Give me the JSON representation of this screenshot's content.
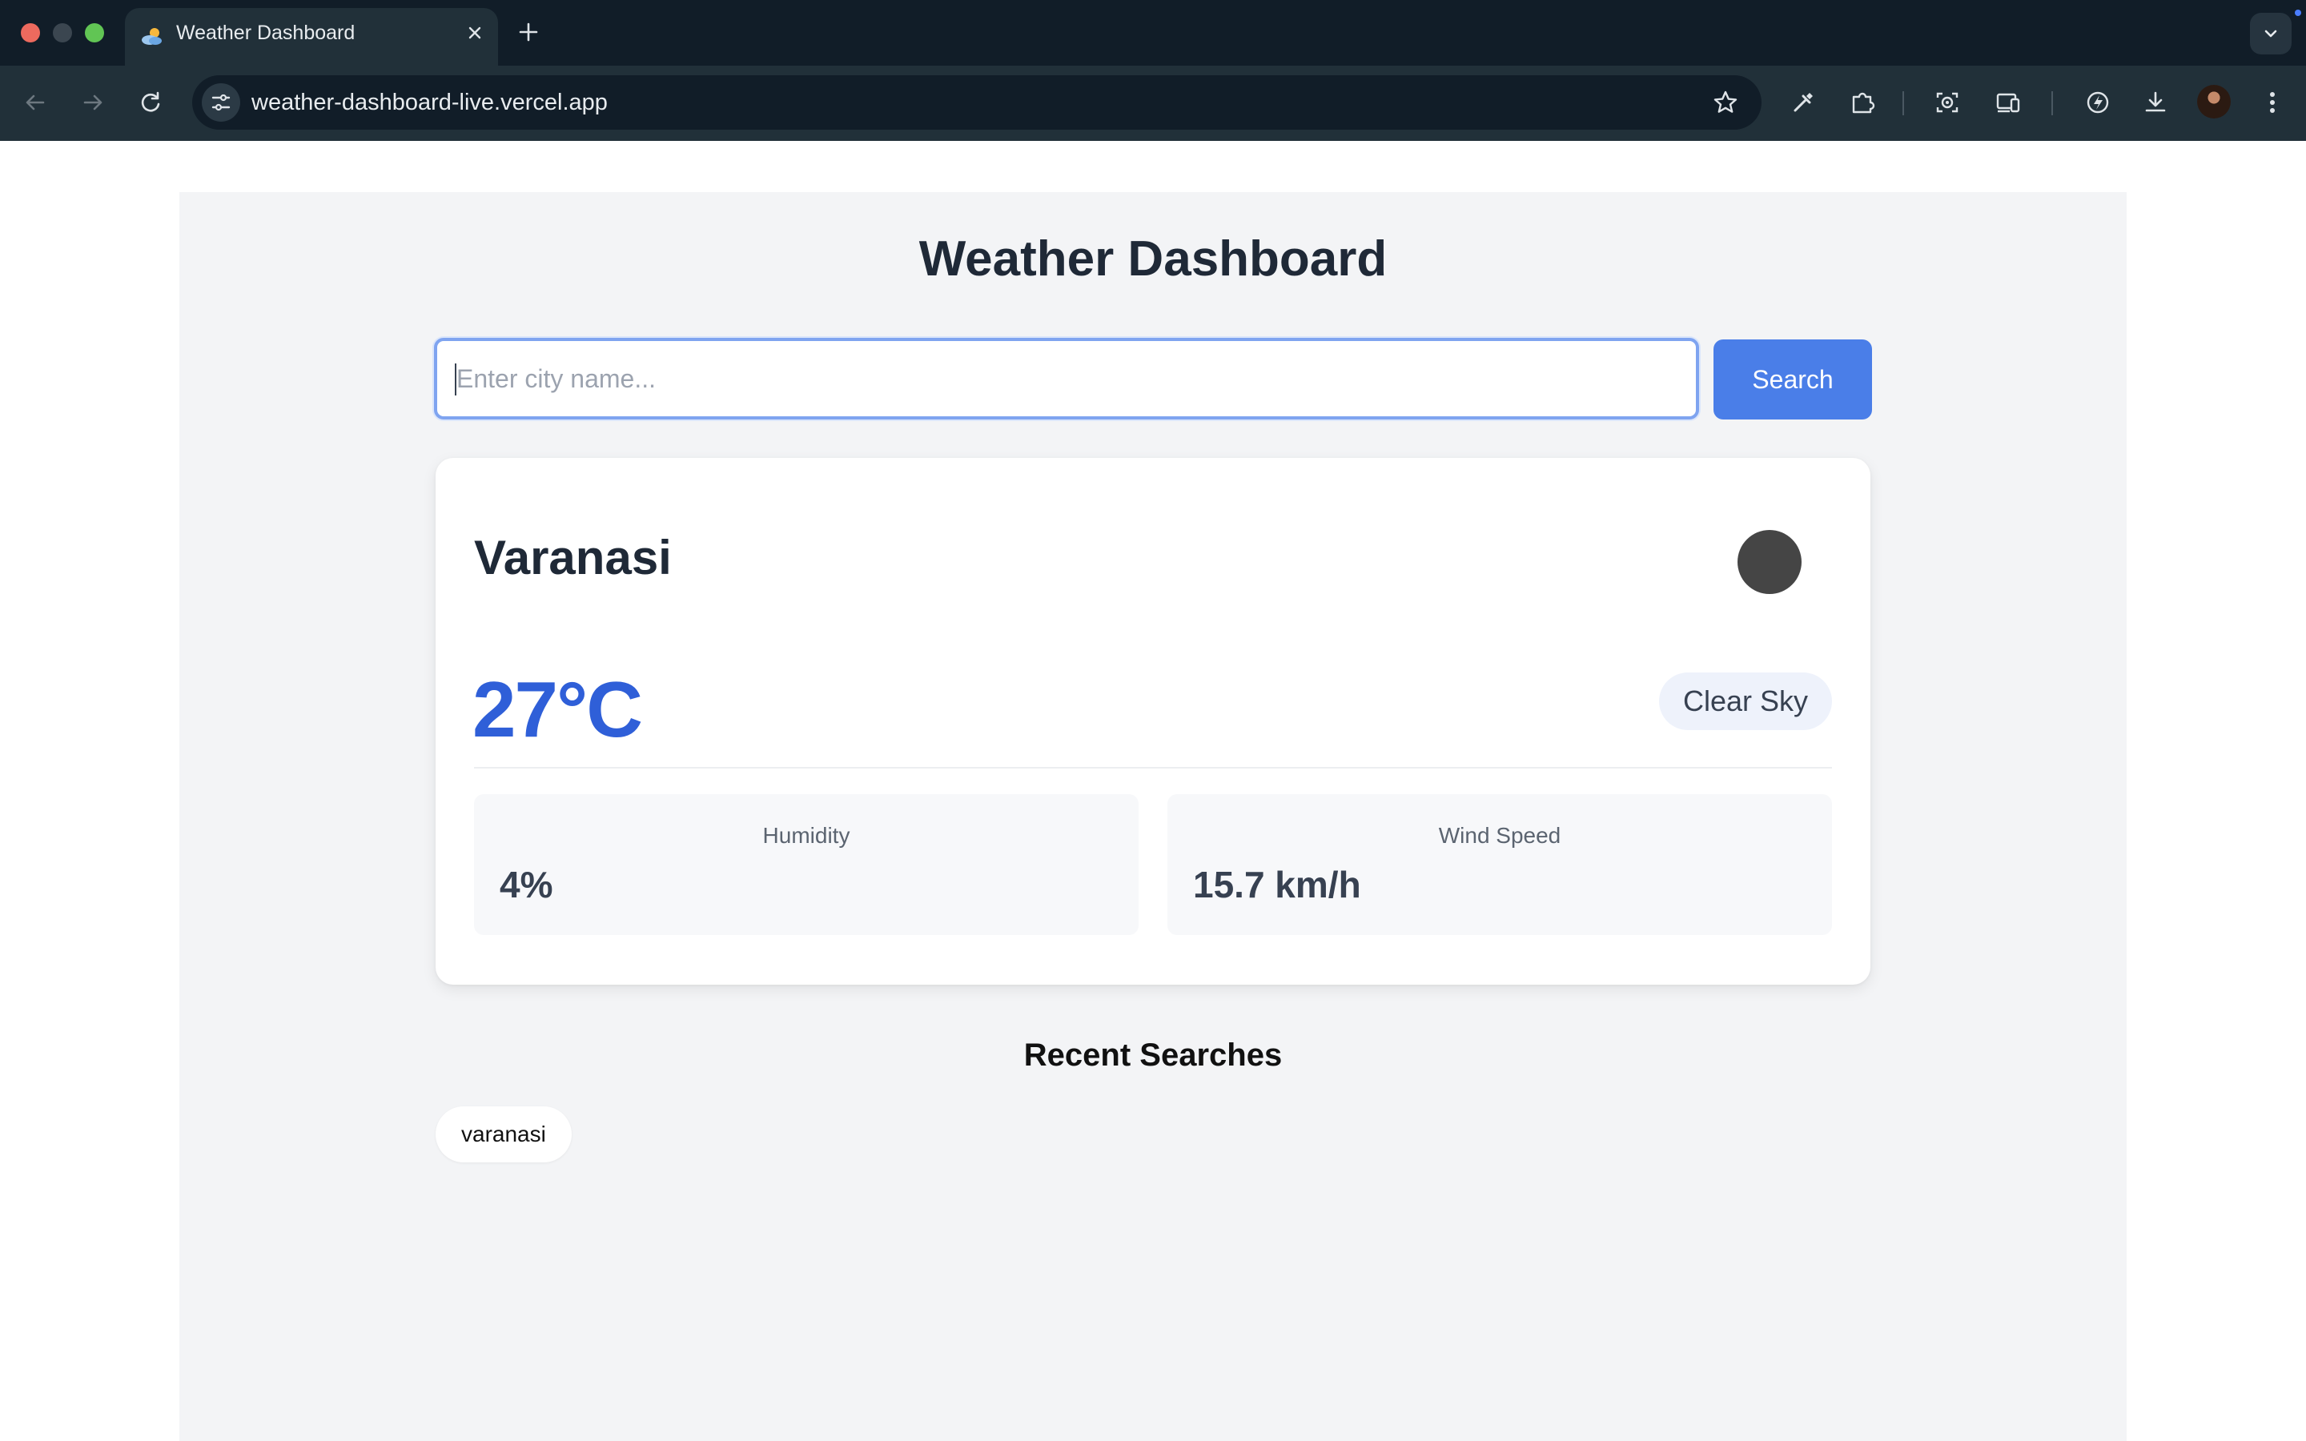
{
  "browser": {
    "tab": {
      "title": "Weather Dashboard",
      "favicon": "weather-favicon-icon"
    },
    "address_bar": {
      "url": "weather-dashboard-live.vercel.app"
    },
    "icons": [
      "back-arrow-icon",
      "forward-arrow-icon",
      "reload-icon",
      "site-info-icon",
      "bookmark-star-icon",
      "eyedropper-icon",
      "extensions-puzzle-icon",
      "screenshot-icon",
      "device-toolbar-icon",
      "performance-icon",
      "download-icon",
      "profile-avatar",
      "more-menu-icon"
    ]
  },
  "app": {
    "title": "Weather Dashboard",
    "search": {
      "placeholder": "Enter city name...",
      "value": "",
      "button_label": "Search"
    },
    "weather": {
      "city": "Varanasi",
      "temperature": "27°C",
      "condition": "Clear Sky",
      "icon": "weather-condition-icon",
      "humidity_label": "Humidity",
      "humidity_value": "4%",
      "wind_label": "Wind Speed",
      "wind_value": "15.7 km/h"
    },
    "recent": {
      "heading": "Recent Searches",
      "items": [
        "varanasi"
      ]
    }
  },
  "colors": {
    "accent": "#4a7ee8",
    "temperature": "#2f5fd8",
    "page_background": "#f3f4f6",
    "chrome_dark": "#111d28"
  }
}
